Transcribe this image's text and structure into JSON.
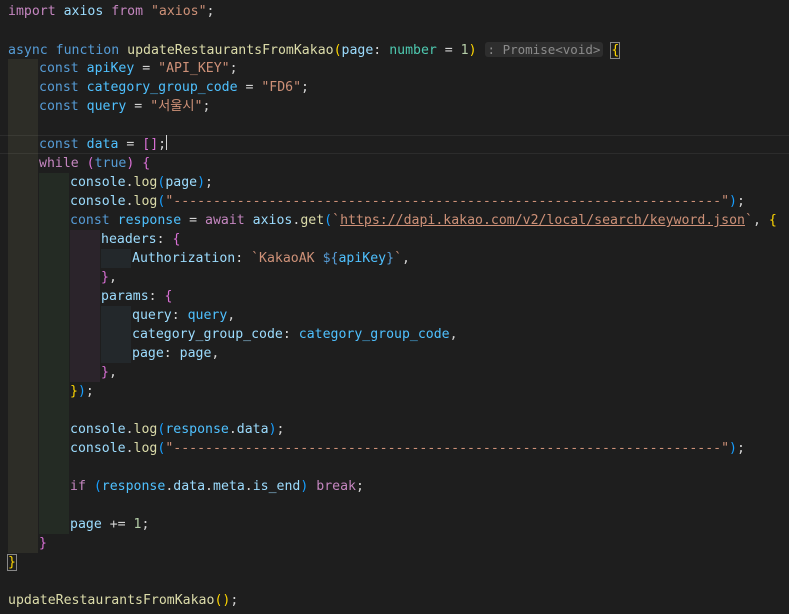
{
  "editor": {
    "language": "typescript",
    "inlay_hint": ": Promise<void>",
    "colors": {
      "background": "#1e1e1e",
      "keyword_control": "#c586c0",
      "keyword_storage": "#569cd6",
      "function": "#dcdcaa",
      "variable": "#9cdcfe",
      "constant": "#4fc1ff",
      "string": "#ce9178",
      "number": "#b5cea8",
      "type": "#4ec9b0",
      "bracket_level1": "#ffd700",
      "bracket_level2": "#da70d6",
      "bracket_level3": "#179fff"
    },
    "lines": [
      {
        "indent": 0,
        "tokens": [
          {
            "t": "import",
            "c": "kw"
          },
          {
            "t": " "
          },
          {
            "t": "axios",
            "c": "var"
          },
          {
            "t": " "
          },
          {
            "t": "from",
            "c": "kw"
          },
          {
            "t": " "
          },
          {
            "t": "\"axios\"",
            "c": "str"
          },
          {
            "t": ";"
          }
        ]
      },
      {
        "indent": 0,
        "tokens": []
      },
      {
        "indent": 0,
        "tokens": [
          {
            "t": "async",
            "c": "st"
          },
          {
            "t": " "
          },
          {
            "t": "function",
            "c": "st"
          },
          {
            "t": " "
          },
          {
            "t": "updateRestaurantsFromKakao",
            "c": "fn"
          },
          {
            "t": "(",
            "c": "b1"
          },
          {
            "t": "page",
            "c": "var"
          },
          {
            "t": ": "
          },
          {
            "t": "number",
            "c": "type"
          },
          {
            "t": " = "
          },
          {
            "t": "1",
            "c": "num"
          },
          {
            "t": ")",
            "c": "b1"
          },
          {
            "t": " "
          },
          {
            "t": ": Promise<void>",
            "c": "hint"
          },
          {
            "t": " "
          },
          {
            "t": "{",
            "c": "b1",
            "m": true
          }
        ]
      },
      {
        "indent": 1,
        "tokens": [
          {
            "t": "const",
            "c": "st"
          },
          {
            "t": " "
          },
          {
            "t": "apiKey",
            "c": "const"
          },
          {
            "t": " = "
          },
          {
            "t": "\"API_KEY\"",
            "c": "str"
          },
          {
            "t": ";"
          }
        ]
      },
      {
        "indent": 1,
        "tokens": [
          {
            "t": "const",
            "c": "st"
          },
          {
            "t": " "
          },
          {
            "t": "category_group_code",
            "c": "const"
          },
          {
            "t": " = "
          },
          {
            "t": "\"FD6\"",
            "c": "str"
          },
          {
            "t": ";"
          }
        ]
      },
      {
        "indent": 1,
        "tokens": [
          {
            "t": "const",
            "c": "st"
          },
          {
            "t": " "
          },
          {
            "t": "query",
            "c": "const"
          },
          {
            "t": " = "
          },
          {
            "t": "\"서울시\"",
            "c": "str"
          },
          {
            "t": ";"
          }
        ]
      },
      {
        "indent": 1,
        "tokens": []
      },
      {
        "indent": 1,
        "cursor": true,
        "tokens": [
          {
            "t": "const",
            "c": "st"
          },
          {
            "t": " "
          },
          {
            "t": "data",
            "c": "const"
          },
          {
            "t": " = "
          },
          {
            "t": "[]",
            "c": "b2"
          },
          {
            "t": ";"
          },
          {
            "caret": true
          }
        ]
      },
      {
        "indent": 1,
        "tokens": [
          {
            "t": "while",
            "c": "kw"
          },
          {
            "t": " "
          },
          {
            "t": "(",
            "c": "b2"
          },
          {
            "t": "true",
            "c": "st"
          },
          {
            "t": ")",
            "c": "b2"
          },
          {
            "t": " "
          },
          {
            "t": "{",
            "c": "b2"
          }
        ]
      },
      {
        "indent": 2,
        "tokens": [
          {
            "t": "console",
            "c": "var"
          },
          {
            "t": "."
          },
          {
            "t": "log",
            "c": "fn"
          },
          {
            "t": "(",
            "c": "b3"
          },
          {
            "t": "page",
            "c": "var"
          },
          {
            "t": ")",
            "c": "b3"
          },
          {
            "t": ";"
          }
        ]
      },
      {
        "indent": 2,
        "tokens": [
          {
            "t": "console",
            "c": "var"
          },
          {
            "t": "."
          },
          {
            "t": "log",
            "c": "fn"
          },
          {
            "t": "(",
            "c": "b3"
          },
          {
            "t": "\"---------------------------------------------------------------------\"",
            "c": "str"
          },
          {
            "t": ")",
            "c": "b3"
          },
          {
            "t": ";"
          }
        ]
      },
      {
        "indent": 2,
        "tokens": [
          {
            "t": "const",
            "c": "st"
          },
          {
            "t": " "
          },
          {
            "t": "response",
            "c": "const"
          },
          {
            "t": " = "
          },
          {
            "t": "await",
            "c": "kw"
          },
          {
            "t": " "
          },
          {
            "t": "axios",
            "c": "var"
          },
          {
            "t": "."
          },
          {
            "t": "get",
            "c": "fn"
          },
          {
            "t": "(",
            "c": "b3"
          },
          {
            "t": "`",
            "c": "str"
          },
          {
            "t": "https://dapi.kakao.com/v2/local/search/keyword.json",
            "c": "url"
          },
          {
            "t": "`",
            "c": "str"
          },
          {
            "t": ", "
          },
          {
            "t": "{",
            "c": "b1"
          }
        ]
      },
      {
        "indent": 3,
        "tokens": [
          {
            "t": "headers",
            "c": "var"
          },
          {
            "t": ": "
          },
          {
            "t": "{",
            "c": "b2"
          }
        ]
      },
      {
        "indent": 4,
        "tokens": [
          {
            "t": "Authorization",
            "c": "var"
          },
          {
            "t": ": "
          },
          {
            "t": "`KakaoAK ",
            "c": "str"
          },
          {
            "t": "${",
            "c": "st"
          },
          {
            "t": "apiKey",
            "c": "const"
          },
          {
            "t": "}",
            "c": "st"
          },
          {
            "t": "`",
            "c": "str"
          },
          {
            "t": ","
          }
        ]
      },
      {
        "indent": 3,
        "tokens": [
          {
            "t": "}",
            "c": "b2"
          },
          {
            "t": ","
          }
        ]
      },
      {
        "indent": 3,
        "tokens": [
          {
            "t": "params",
            "c": "var"
          },
          {
            "t": ": "
          },
          {
            "t": "{",
            "c": "b2"
          }
        ]
      },
      {
        "indent": 4,
        "tokens": [
          {
            "t": "query",
            "c": "var"
          },
          {
            "t": ": "
          },
          {
            "t": "query",
            "c": "const"
          },
          {
            "t": ","
          }
        ]
      },
      {
        "indent": 4,
        "tokens": [
          {
            "t": "category_group_code",
            "c": "var"
          },
          {
            "t": ": "
          },
          {
            "t": "category_group_code",
            "c": "const"
          },
          {
            "t": ","
          }
        ]
      },
      {
        "indent": 4,
        "tokens": [
          {
            "t": "page",
            "c": "var"
          },
          {
            "t": ": "
          },
          {
            "t": "page",
            "c": "var"
          },
          {
            "t": ","
          }
        ]
      },
      {
        "indent": 3,
        "tokens": [
          {
            "t": "}",
            "c": "b2"
          },
          {
            "t": ","
          }
        ]
      },
      {
        "indent": 2,
        "tokens": [
          {
            "t": "}",
            "c": "b1"
          },
          {
            "t": ")",
            "c": "b3"
          },
          {
            "t": ";"
          }
        ]
      },
      {
        "indent": 2,
        "tokens": []
      },
      {
        "indent": 2,
        "tokens": [
          {
            "t": "console",
            "c": "var"
          },
          {
            "t": "."
          },
          {
            "t": "log",
            "c": "fn"
          },
          {
            "t": "(",
            "c": "b3"
          },
          {
            "t": "response",
            "c": "const"
          },
          {
            "t": "."
          },
          {
            "t": "data",
            "c": "var"
          },
          {
            "t": ")",
            "c": "b3"
          },
          {
            "t": ";"
          }
        ]
      },
      {
        "indent": 2,
        "tokens": [
          {
            "t": "console",
            "c": "var"
          },
          {
            "t": "."
          },
          {
            "t": "log",
            "c": "fn"
          },
          {
            "t": "(",
            "c": "b3"
          },
          {
            "t": "\"---------------------------------------------------------------------\"",
            "c": "str"
          },
          {
            "t": ")",
            "c": "b3"
          },
          {
            "t": ";"
          }
        ]
      },
      {
        "indent": 2,
        "tokens": []
      },
      {
        "indent": 2,
        "tokens": [
          {
            "t": "if",
            "c": "kw"
          },
          {
            "t": " "
          },
          {
            "t": "(",
            "c": "b3"
          },
          {
            "t": "response",
            "c": "const"
          },
          {
            "t": "."
          },
          {
            "t": "data",
            "c": "var"
          },
          {
            "t": "."
          },
          {
            "t": "meta",
            "c": "var"
          },
          {
            "t": "."
          },
          {
            "t": "is_end",
            "c": "var"
          },
          {
            "t": ")",
            "c": "b3"
          },
          {
            "t": " "
          },
          {
            "t": "break",
            "c": "kw"
          },
          {
            "t": ";"
          }
        ]
      },
      {
        "indent": 2,
        "tokens": []
      },
      {
        "indent": 2,
        "tokens": [
          {
            "t": "page",
            "c": "var"
          },
          {
            "t": " += "
          },
          {
            "t": "1",
            "c": "num"
          },
          {
            "t": ";"
          }
        ]
      },
      {
        "indent": 1,
        "tokens": [
          {
            "t": "}",
            "c": "b2"
          }
        ]
      },
      {
        "indent": 0,
        "tokens": [
          {
            "t": "}",
            "c": "b1",
            "m": true
          }
        ]
      },
      {
        "indent": 0,
        "tokens": []
      },
      {
        "indent": 0,
        "tokens": [
          {
            "t": "updateRestaurantsFromKakao",
            "c": "fn"
          },
          {
            "t": "(",
            "c": "b1"
          },
          {
            "t": ")",
            "c": "b1"
          },
          {
            "t": ";"
          }
        ]
      }
    ]
  }
}
